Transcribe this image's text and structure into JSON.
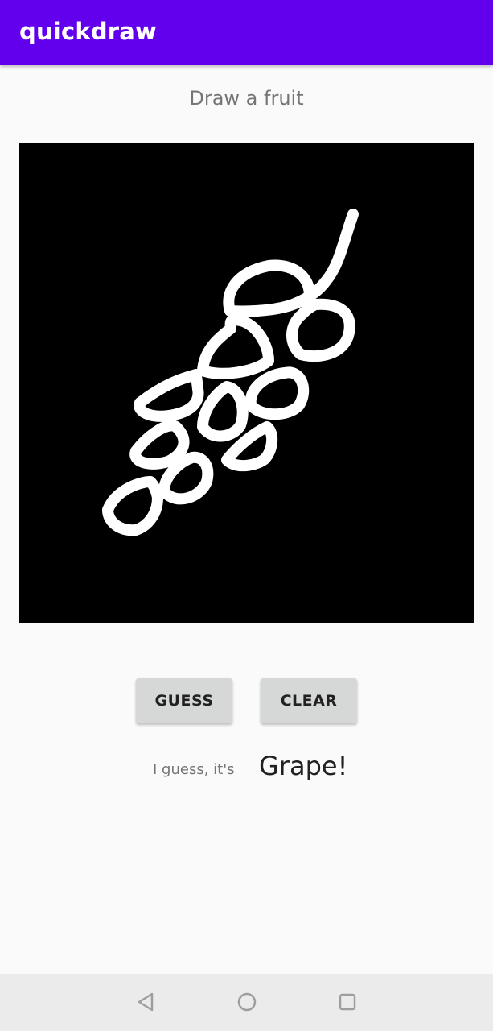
{
  "app": {
    "title": "quickdraw",
    "accent_color": "#6200ee"
  },
  "prompt": "Draw a fruit",
  "canvas": {
    "background": "#000000",
    "stroke_color": "#ffffff",
    "drawing_subject": "grapes"
  },
  "buttons": {
    "guess_label": "GUESS",
    "clear_label": "CLEAR"
  },
  "result": {
    "label": "I guess, it's",
    "value": "Grape!"
  },
  "nav_bar": {
    "back_icon": "triangle-back-icon",
    "home_icon": "circle-home-icon",
    "recent_icon": "square-recents-icon"
  }
}
